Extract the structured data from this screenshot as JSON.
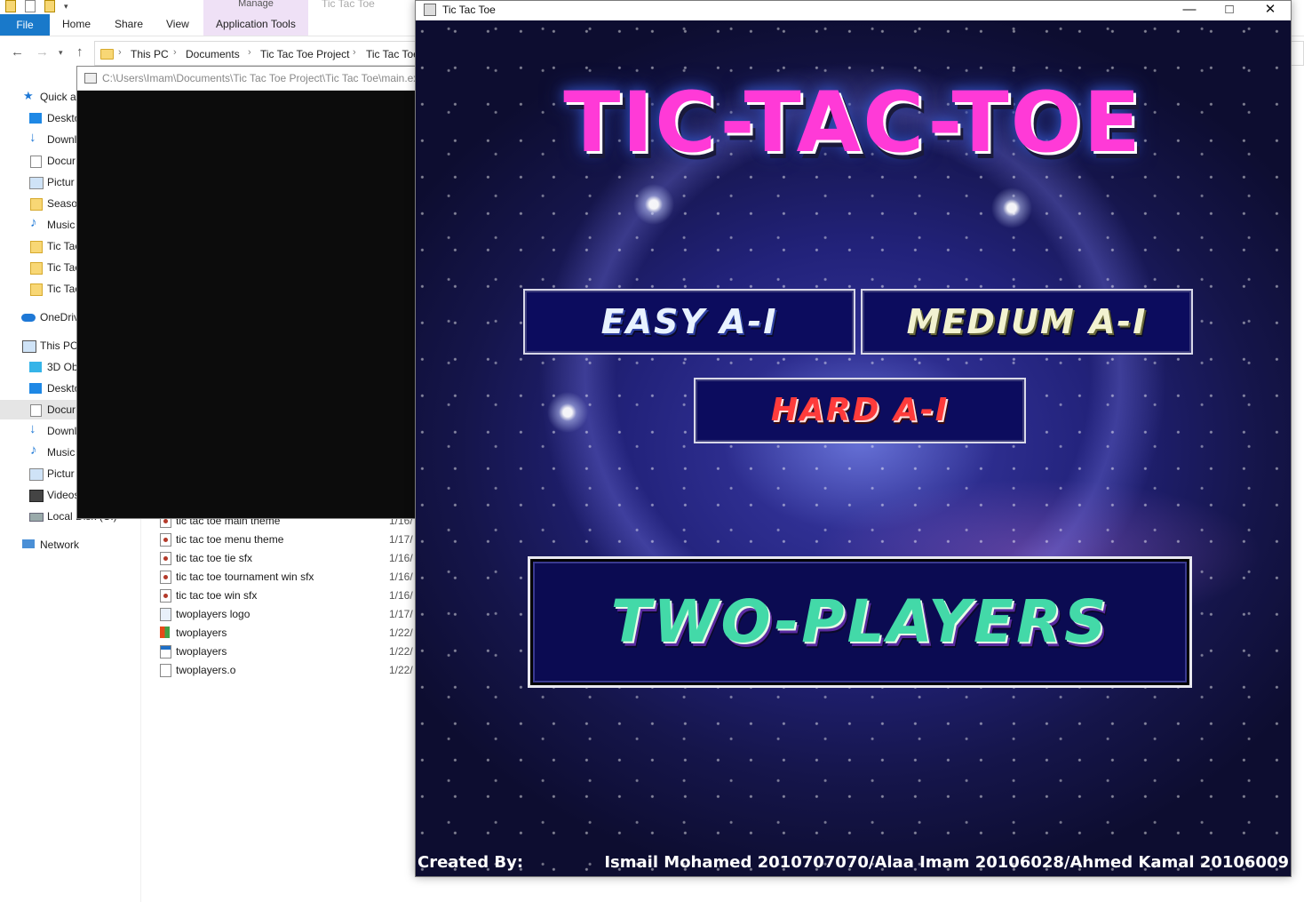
{
  "explorer": {
    "ribbon": {
      "manage_label": "Manage",
      "title_ghost": "Tic Tac Toe",
      "tabs": [
        "File",
        "Home",
        "Share",
        "View",
        "Application Tools"
      ]
    },
    "breadcrumb": [
      "This PC",
      "Documents",
      "Tic Tac Toe Project",
      "Tic Tac Toe"
    ],
    "sidebar": [
      {
        "label": "Quick a",
        "icon": "star-icon"
      },
      {
        "label": "Deskto",
        "icon": "desktop-icon"
      },
      {
        "label": "Downl",
        "icon": "download-icon"
      },
      {
        "label": "Docur",
        "icon": "document-icon"
      },
      {
        "label": "Pictur",
        "icon": "pictures-icon"
      },
      {
        "label": "Season",
        "icon": "folder-icon"
      },
      {
        "label": "Music",
        "icon": "music-icon"
      },
      {
        "label": "Tic Tac",
        "icon": "folder-icon"
      },
      {
        "label": "Tic Tac",
        "icon": "folder-icon"
      },
      {
        "label": "Tic Tac",
        "icon": "folder-icon"
      },
      {
        "label": "OneDriv",
        "icon": "cloud-icon"
      },
      {
        "label": "This PC",
        "icon": "computer-icon"
      },
      {
        "label": "3D Ob",
        "icon": "cube-icon"
      },
      {
        "label": "Deskto",
        "icon": "desktop-icon"
      },
      {
        "label": "Docur",
        "icon": "document-icon"
      },
      {
        "label": "Downl",
        "icon": "download-icon"
      },
      {
        "label": "Music",
        "icon": "music-icon"
      },
      {
        "label": "Pictur",
        "icon": "pictures-icon"
      },
      {
        "label": "Videos",
        "icon": "video-icon"
      },
      {
        "label": "Local Disk (C:)",
        "icon": "disk-icon"
      },
      {
        "label": "Network",
        "icon": "network-icon"
      }
    ],
    "files": [
      {
        "name": "tic tac toe main theme",
        "date": "1/16/",
        "type": "audio"
      },
      {
        "name": "tic tac toe menu theme",
        "date": "1/17/",
        "type": "audio"
      },
      {
        "name": "tic tac toe tie sfx",
        "date": "1/16/",
        "type": "audio"
      },
      {
        "name": "tic tac toe tournament win sfx",
        "date": "1/16/",
        "type": "audio"
      },
      {
        "name": "tic tac toe win sfx",
        "date": "1/16/",
        "type": "audio"
      },
      {
        "name": "twoplayers logo",
        "date": "1/17/",
        "type": "image"
      },
      {
        "name": "twoplayers",
        "date": "1/22/",
        "type": "exe"
      },
      {
        "name": "twoplayers",
        "date": "1/22/",
        "type": "exe2"
      },
      {
        "name": "twoplayers.o",
        "date": "1/22/",
        "type": "file"
      }
    ]
  },
  "console": {
    "title": "C:\\Users\\Imam\\Documents\\Tic Tac Toe Project\\Tic Tac Toe\\main.exe"
  },
  "game": {
    "window_title": "Tic Tac Toe",
    "logo_text": "TiC-TAC-TOE",
    "buttons": {
      "easy": "EASY A-I",
      "medium": "MEDIUM A-I",
      "hard": "HARD A-I",
      "two_players": "TWO-PLAYERS"
    },
    "credits_label": "Created By:",
    "credits_names": "Ismail Mohamed 2010707070/Alaa Imam 20106028/Ahmed Kamal 20106009",
    "colors": {
      "logo": "#ff3ad7",
      "easy": "#e8f2ff",
      "medium": "#f2f2d0",
      "hard": "#ff3b3b",
      "two_players": "#43d9a8",
      "button_bg": "#0c0c5e"
    }
  }
}
